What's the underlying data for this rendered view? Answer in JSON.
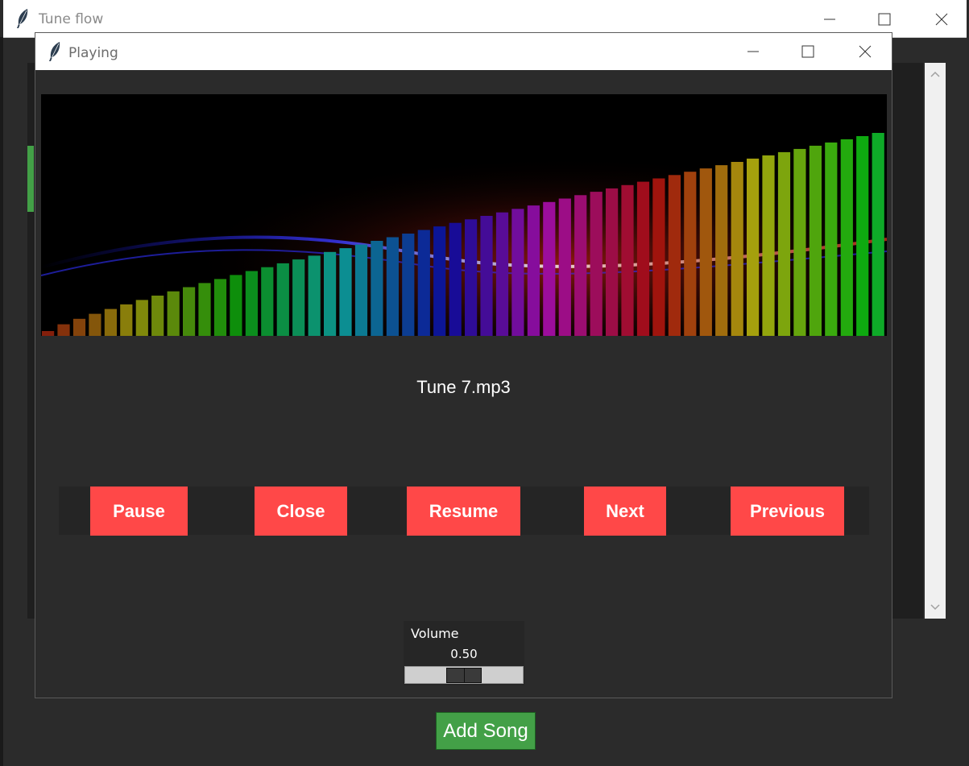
{
  "main_window": {
    "title": "Tune flow",
    "add_song_label": "Add Song",
    "accent_color": "#43a047"
  },
  "player_window": {
    "title": "Playing",
    "track_name": "Tune 7.mp3",
    "buttons": {
      "pause": "Pause",
      "close": "Close",
      "resume": "Resume",
      "next": "Next",
      "previous": "Previous"
    },
    "button_color": "#ff4848",
    "volume": {
      "label": "Volume",
      "value_text": "0.50",
      "level": 0.5
    }
  },
  "icons": {
    "app_icon": "feather-icon",
    "minimize": "minimize-icon",
    "maximize": "maximize-icon",
    "close": "close-icon"
  }
}
